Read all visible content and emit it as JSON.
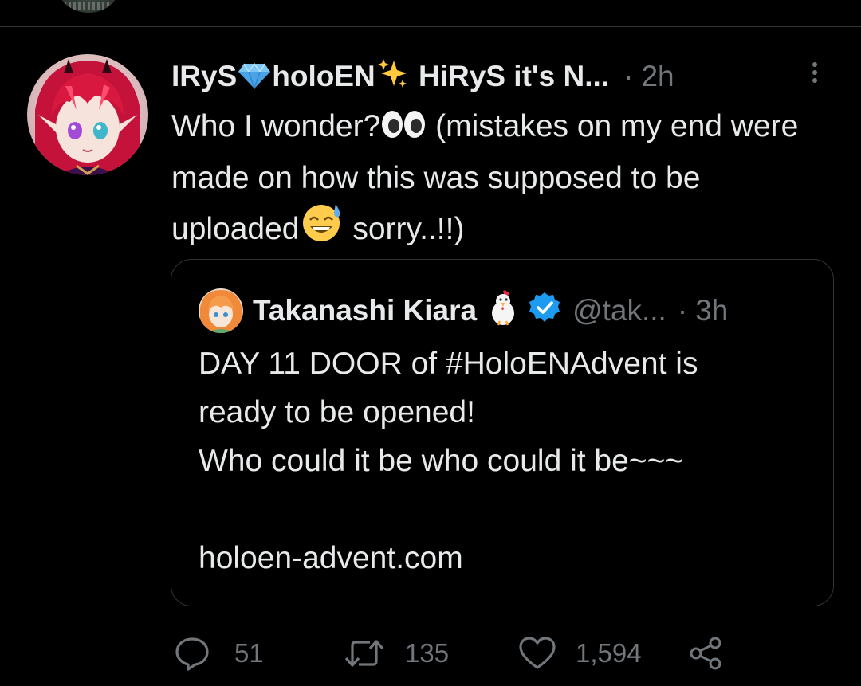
{
  "tweet": {
    "display_name_part1": "IRyS",
    "display_name_part2": "holoEN",
    "display_name_part3": " HiRyS it's N...",
    "time_separator": "·",
    "time": "2h",
    "text_part1": "Who I wonder?",
    "text_part2": " (mistakes on my end were made on how this was supposed to be uploaded",
    "text_part3": " sorry..!!)"
  },
  "quote": {
    "display_name": "Takanashi Kiara",
    "handle": "@tak...",
    "time_separator": "·",
    "time": "3h",
    "lines": [
      "DAY 11 DOOR of #HoloENAdvent is",
      "ready to be opened!",
      "Who could it be who could it be~~~",
      "",
      "holoen-advent.com"
    ]
  },
  "actions": {
    "reply_count": "51",
    "retweet_count": "135",
    "like_count": "1,594"
  },
  "icons": {
    "diamond": "gem-icon",
    "sparkles": "sparkles-icon",
    "eyes": "eyes-emoji-icon",
    "sweat_smile": "sweat-smile-emoji-icon",
    "chicken": "chicken-emoji-icon",
    "verified": "verified-badge-icon",
    "reply": "reply-icon",
    "retweet": "retweet-icon",
    "like": "heart-icon",
    "share": "share-icon",
    "more": "more-vertical-icon"
  },
  "colors": {
    "background": "#000000",
    "text_primary": "#e7e9ea",
    "text_secondary": "#71767b",
    "border": "#2f3336",
    "verified_blue": "#1d9bf0"
  }
}
